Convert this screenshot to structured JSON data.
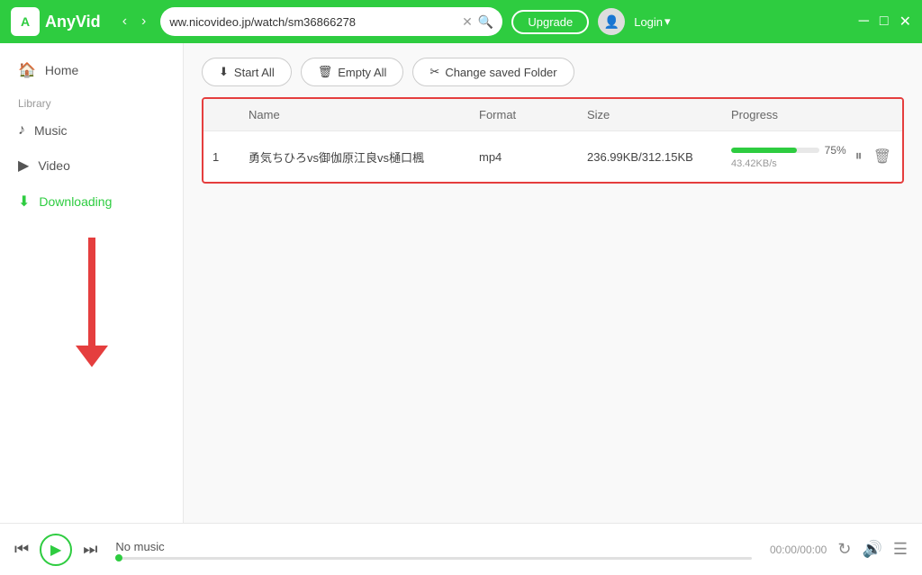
{
  "titlebar": {
    "logo_text": "A",
    "app_name": "AnyVid",
    "url": "ww.nicovideo.jp/watch/sm36866278",
    "upgrade_label": "Upgrade",
    "login_label": "Login",
    "nav_back": "‹",
    "nav_forward": "›"
  },
  "sidebar": {
    "library_label": "Library",
    "home_label": "Home",
    "music_label": "Music",
    "video_label": "Video",
    "downloading_label": "Downloading"
  },
  "toolbar": {
    "start_all_label": "Start All",
    "empty_all_label": "Empty All",
    "change_folder_label": "Change saved Folder"
  },
  "table": {
    "col_num": "",
    "col_name": "Name",
    "col_format": "Format",
    "col_size": "Size",
    "col_progress": "Progress",
    "rows": [
      {
        "num": "1",
        "name": "勇気ちひろvs御伽原江良vs樋口楓",
        "format": "mp4",
        "size": "236.99KB/312.15KB",
        "progress_pct": 75,
        "speed": "43.42KB/s",
        "progress_label": "75%"
      }
    ]
  },
  "player": {
    "no_music": "No music",
    "time": "00:00/00:00"
  }
}
